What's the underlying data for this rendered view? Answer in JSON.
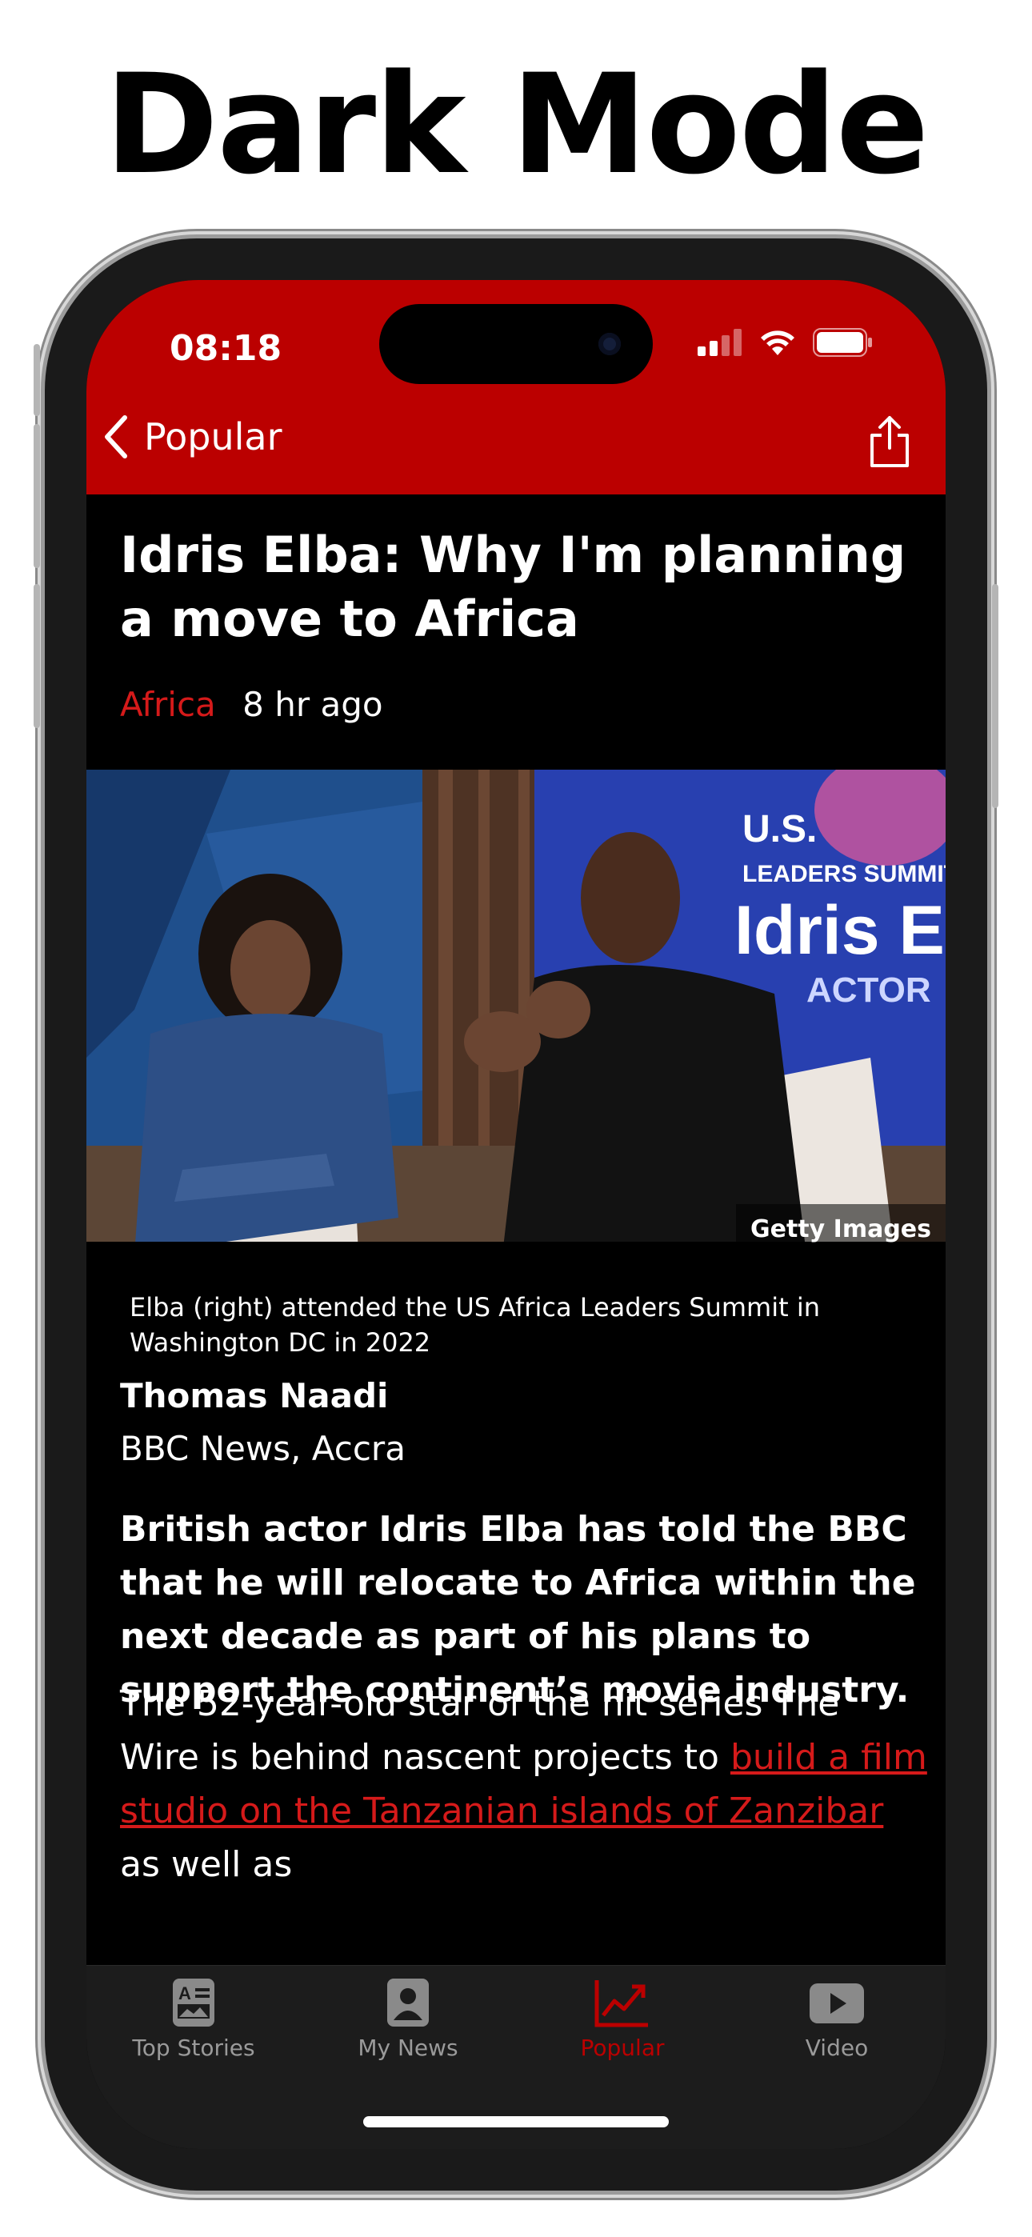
{
  "page_heading": "Dark Mode",
  "status_bar": {
    "time": "08:18"
  },
  "navbar": {
    "back_label": "Popular"
  },
  "article": {
    "title": "Idris Elba: Why I'm planning a move to Africa",
    "category": "Africa",
    "time_ago": "8 hr ago",
    "image_credit": "Getty Images",
    "image_caption": "Elba (right) attended the US Africa Leaders Summit in Washington DC in 2022",
    "author": "Thomas Naadi",
    "dept": "BBC News, Accra",
    "lede": "British actor Idris Elba has told the BBC that he will relocate to Africa within the next decade as part of his plans to support the continent’s movie industry.",
    "para_start": "The 52-year-old star of the hit series The Wire is behind nascent projects to ",
    "para_link": "build a film studio on the Tanzanian islands of Zanzibar",
    "para_end": " as well as"
  },
  "tabs": [
    {
      "label": "Top Stories",
      "icon": "news-icon",
      "active": false
    },
    {
      "label": "My News",
      "icon": "person-icon",
      "active": false
    },
    {
      "label": "Popular",
      "icon": "trending-icon",
      "active": true
    },
    {
      "label": "Video",
      "icon": "play-icon",
      "active": false
    }
  ],
  "colors": {
    "brand_red": "#bb0000",
    "link_red": "#d51a1a",
    "background": "#000000"
  }
}
